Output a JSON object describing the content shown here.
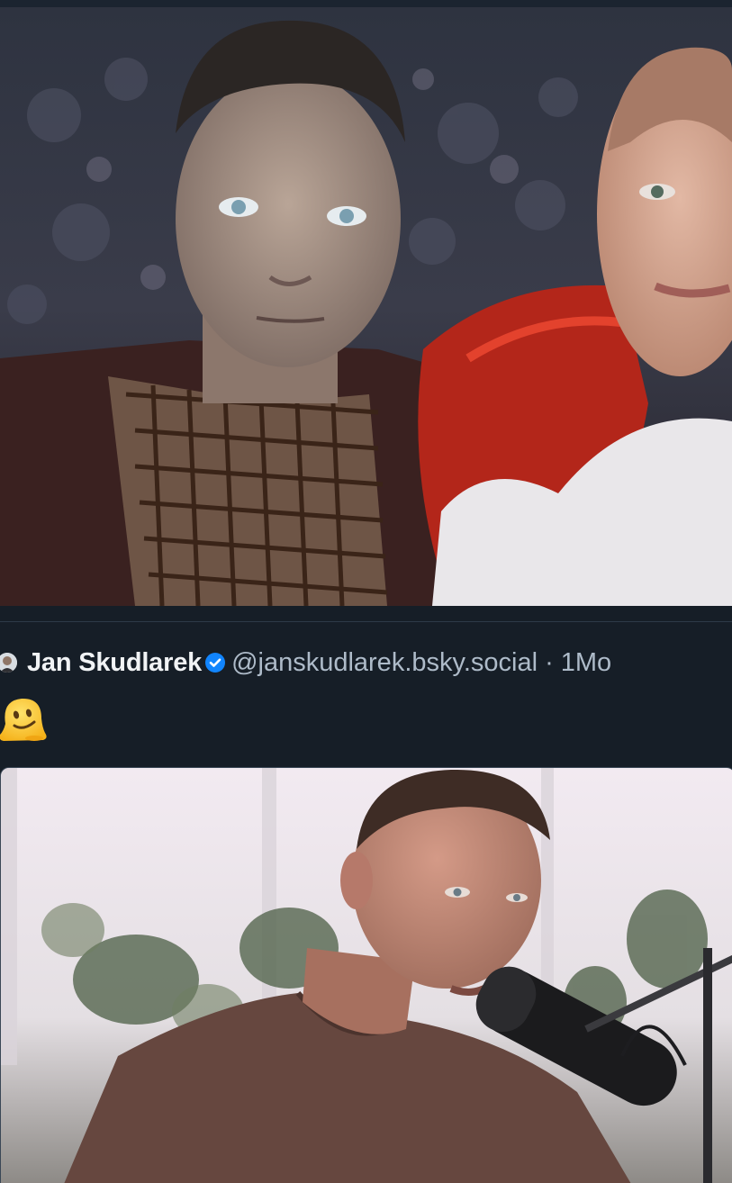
{
  "post": {
    "author": {
      "display_name": "Jan Skudlarek",
      "handle": "@janskudlarek.bsky.social",
      "verified": true
    },
    "separator": "·",
    "timestamp": "1Mo",
    "body_emoji": "melting-face",
    "media_description": "Close-up photo of a man in a t-shirt speaking into a podcast microphone"
  },
  "previous_post": {
    "media_description": "Film still of a pale man in a net shirt and fur coat next to a bald woman with red and white feathers"
  },
  "icons": {
    "verified": "verified-check-icon",
    "avatar": "author-avatar"
  },
  "colors": {
    "background": "#161e27",
    "text_primary": "#f1f3f5",
    "text_secondary": "#aebbc9",
    "verified_blue": "#1185fe",
    "divider": "#2e3a48"
  }
}
